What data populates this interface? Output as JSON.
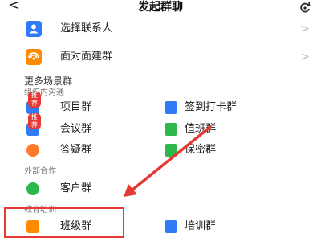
{
  "header": {
    "back_glyph": "<",
    "title": "发起群聊",
    "refresh_icon": "refresh-icon"
  },
  "contacts_section": {
    "rows": [
      {
        "label": "选择联系人",
        "icon": "contact-icon",
        "color": "#2f7cf6"
      },
      {
        "label": "面对面建群",
        "icon": "face-to-face-icon",
        "color": "#ff8a00"
      }
    ],
    "chevron": ">"
  },
  "scenes": {
    "title": "更多场景群",
    "groups": [
      {
        "title": "组织内沟通",
        "items": [
          {
            "label": "项目群",
            "icon": "project-icon",
            "color": "#2f7cf6",
            "badge": "推荐"
          },
          {
            "label": "签到打卡群",
            "icon": "checkin-icon",
            "color": "#2f7cf6",
            "badge": ""
          },
          {
            "label": "会议群",
            "icon": "meeting-icon",
            "color": "#2f7cf6",
            "badge": "推荐"
          },
          {
            "label": "值班群",
            "icon": "duty-icon",
            "color": "#2db84d",
            "badge": ""
          },
          {
            "label": "答疑群",
            "icon": "qa-icon",
            "color": "#ff7a29",
            "badge": ""
          },
          {
            "label": "保密群",
            "icon": "secret-icon",
            "color": "#2db84d",
            "badge": ""
          }
        ]
      },
      {
        "title": "外部合作",
        "items": [
          {
            "label": "客户群",
            "icon": "customer-icon",
            "color": "#2db84d",
            "badge": ""
          }
        ]
      },
      {
        "title": "教育培训",
        "items": [
          {
            "label": "班级群",
            "icon": "class-icon",
            "color": "#ff8a00",
            "badge": ""
          },
          {
            "label": "培训群",
            "icon": "training-icon",
            "color": "#2f7cf6",
            "badge": ""
          }
        ]
      }
    ]
  },
  "annotation": {
    "color": "#e53935",
    "highlighted_item": "班级群"
  }
}
